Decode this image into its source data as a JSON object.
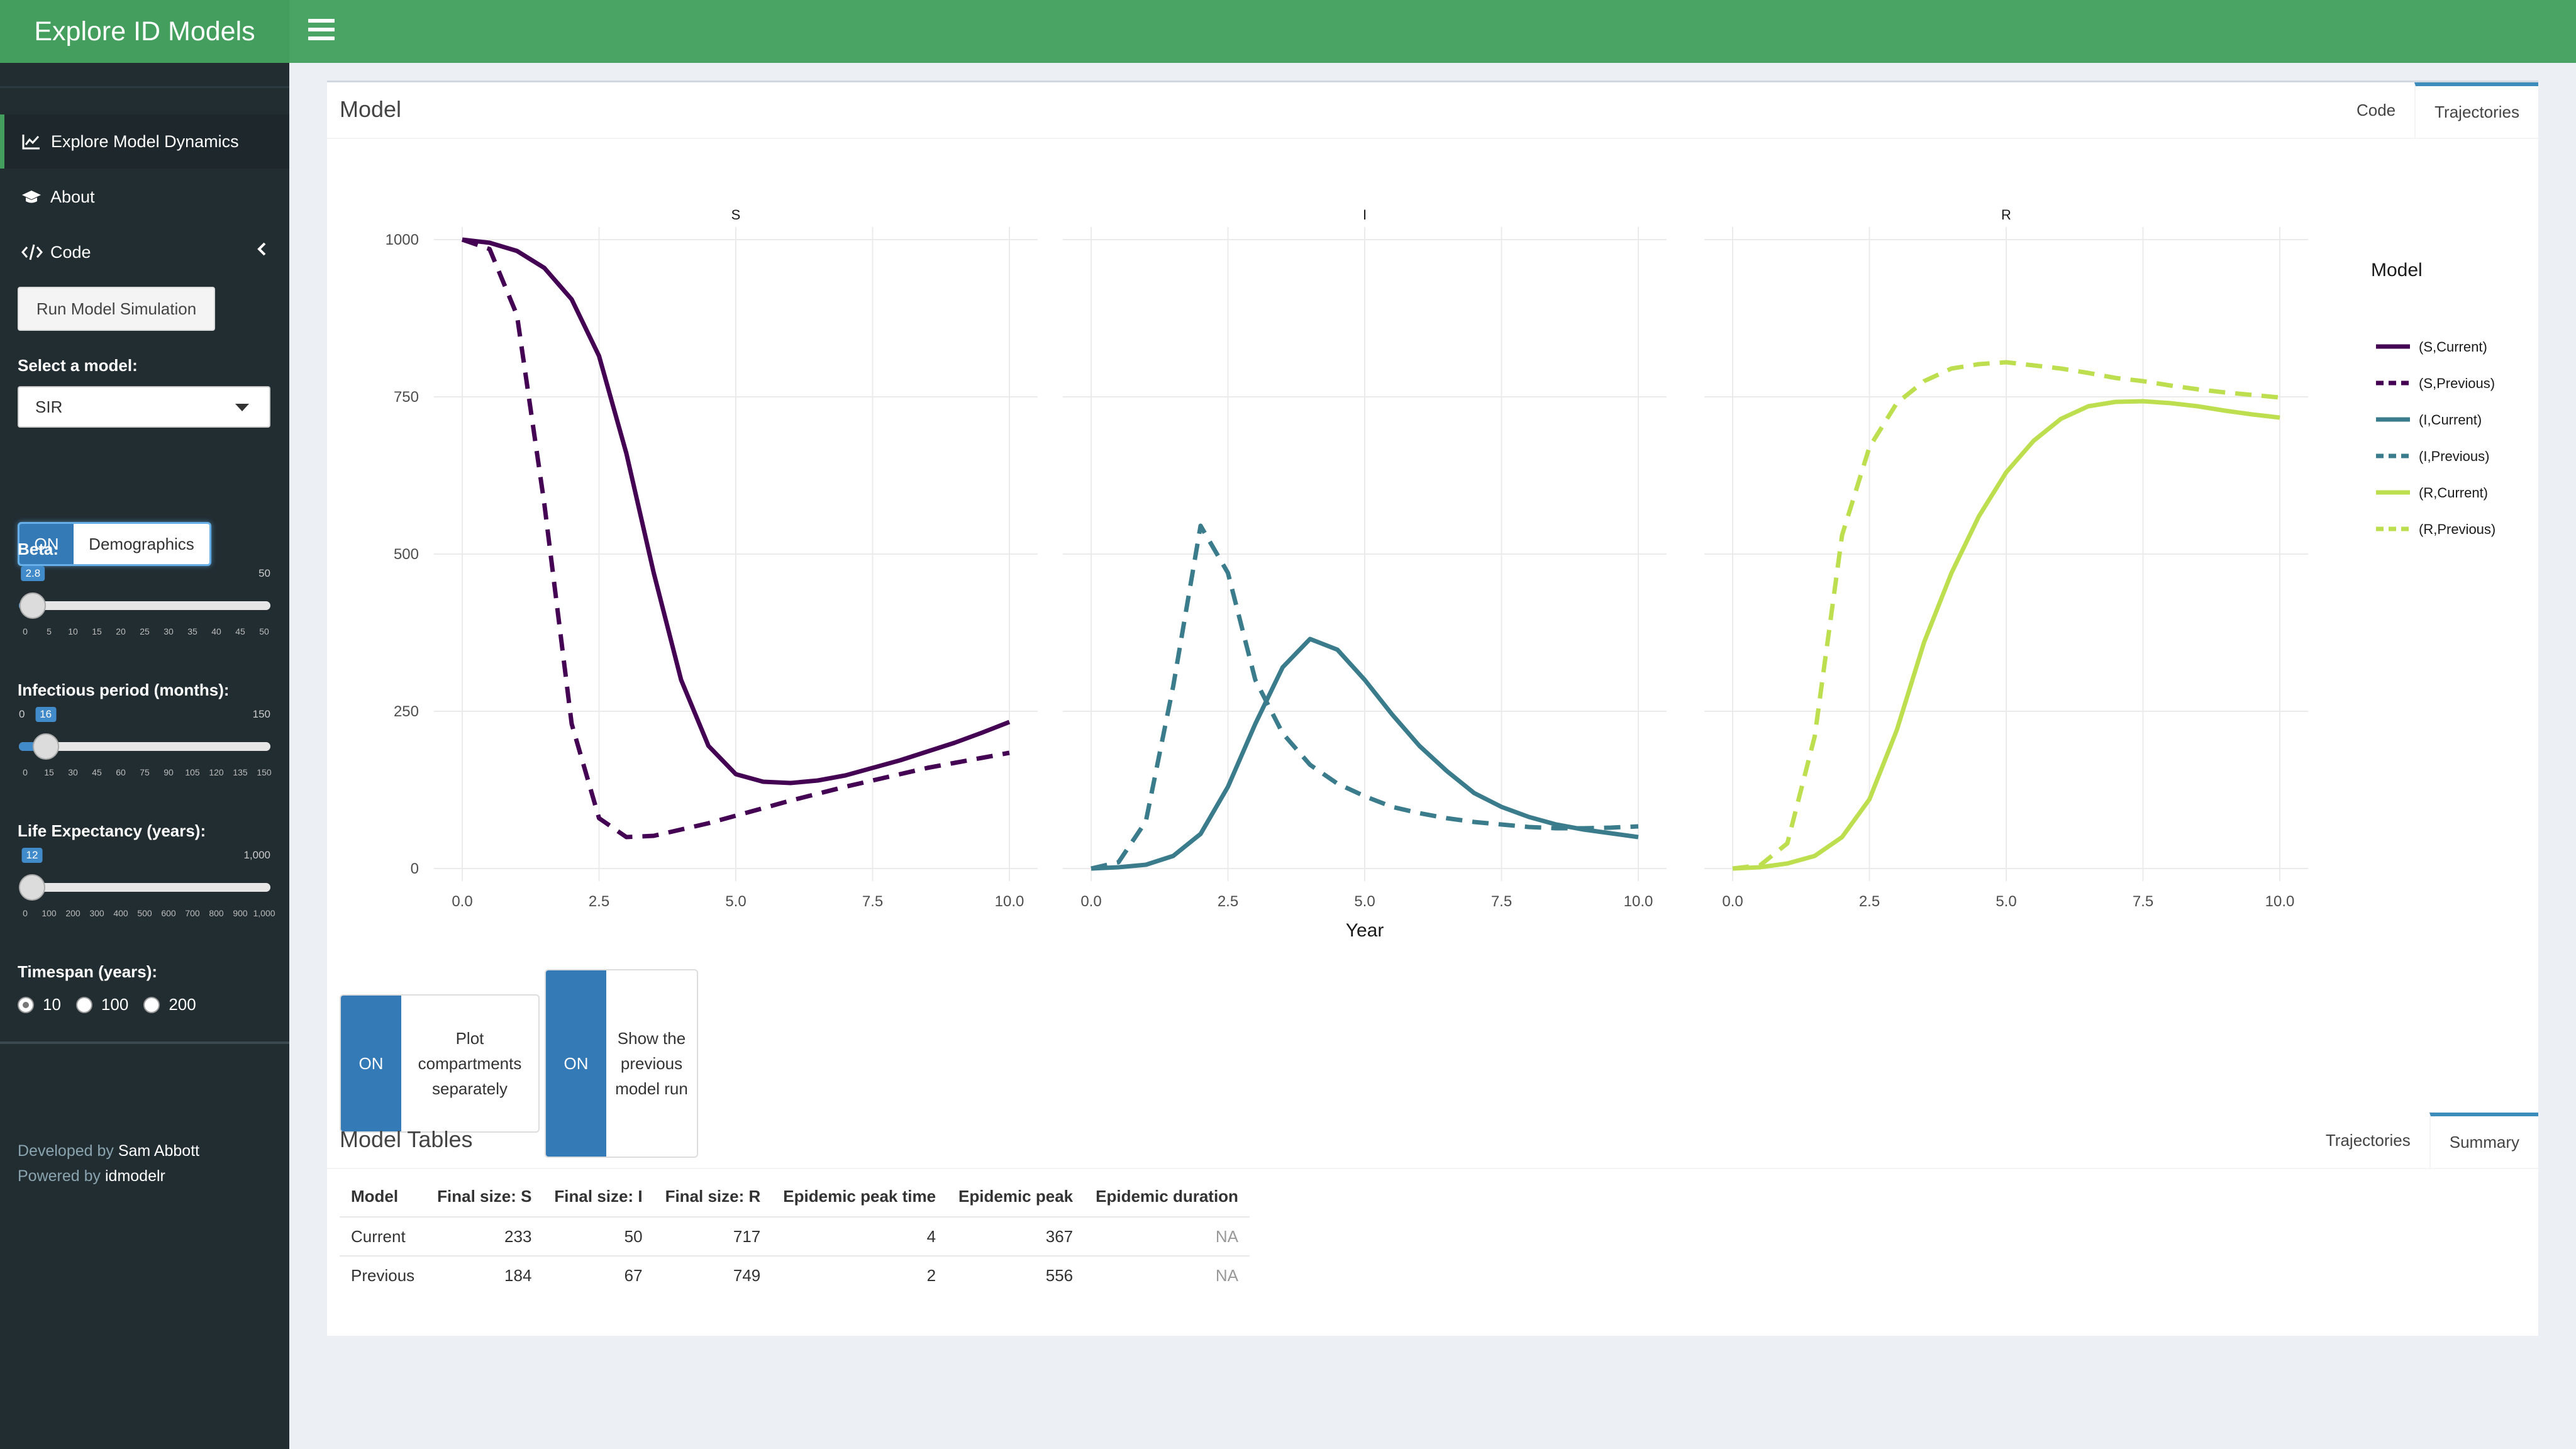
{
  "app": {
    "title": "Explore ID Models"
  },
  "sidebar": {
    "items": [
      {
        "label": "Explore Model Dynamics",
        "icon": "line-chart-icon"
      },
      {
        "label": "About",
        "icon": "graduation-cap-icon"
      },
      {
        "label": "Code",
        "icon": "code-icon"
      }
    ],
    "run_button": "Run Model Simulation",
    "model_label": "Select a model:",
    "model_value": "SIR",
    "demographics": {
      "on": "ON",
      "label": "Demographics"
    },
    "beta": {
      "label": "Beta:",
      "min": "0",
      "max": "50",
      "value": "2.8",
      "value_num": 2.8,
      "min_num": 0,
      "max_num": 50,
      "ticks": [
        "0",
        "5",
        "10",
        "15",
        "20",
        "25",
        "30",
        "35",
        "40",
        "45",
        "50"
      ]
    },
    "infectious": {
      "label": "Infectious period (months):",
      "min": "0",
      "max": "150",
      "value": "16",
      "value_num": 16,
      "min_num": 0,
      "max_num": 150,
      "ticks": [
        "0",
        "15",
        "30",
        "45",
        "60",
        "75",
        "90",
        "105",
        "120",
        "135",
        "150"
      ]
    },
    "life": {
      "label": "Life Expectancy (years):",
      "min": "0",
      "max": "1,000",
      "value": "12",
      "value_num": 12,
      "min_num": 0,
      "max_num": 1000,
      "ticks": [
        "0",
        "100",
        "200",
        "300",
        "400",
        "500",
        "600",
        "700",
        "800",
        "900",
        "1,000"
      ]
    },
    "timespan": {
      "label": "Timespan (years):",
      "options": [
        "10",
        "100",
        "200"
      ],
      "selected": "10"
    },
    "credits": {
      "developed_by": "Developed by",
      "author": "Sam Abbott",
      "powered_by": "Powered by",
      "package": "idmodelr"
    }
  },
  "model_box": {
    "title": "Model",
    "tabs": [
      "Code",
      "Trajectories"
    ],
    "active_tab": "Trajectories"
  },
  "toggles": {
    "plot_separately": {
      "on": "ON",
      "label": "Plot compartments separately"
    },
    "show_previous": {
      "on": "ON",
      "label": "Show the previous model run"
    }
  },
  "tables_box": {
    "title": "Model Tables",
    "tabs": [
      "Trajectories",
      "Summary"
    ],
    "active_tab": "Summary",
    "columns": [
      "Model",
      "Final size: S",
      "Final size: I",
      "Final size: R",
      "Epidemic peak time",
      "Epidemic peak",
      "Epidemic duration"
    ],
    "rows": [
      [
        "Current",
        "233",
        "50",
        "717",
        "4",
        "367",
        "NA"
      ],
      [
        "Previous",
        "184",
        "67",
        "749",
        "2",
        "556",
        "NA"
      ]
    ]
  },
  "chart_data": {
    "type": "line",
    "xlabel": "Year",
    "ylabel": "",
    "facets": [
      "S",
      "I",
      "R"
    ],
    "xlim": [
      0,
      10
    ],
    "ylim": [
      0,
      1000
    ],
    "xticks": [
      "0.0",
      "2.5",
      "5.0",
      "7.5",
      "10.0"
    ],
    "yticks": [
      "0",
      "250",
      "500",
      "750",
      "1000"
    ],
    "legend_title": "Model",
    "legend_position": "right",
    "grid": true,
    "x": [
      0,
      0.5,
      1,
      1.5,
      2,
      2.5,
      3,
      3.5,
      4,
      4.5,
      5,
      5.5,
      6,
      6.5,
      7,
      7.5,
      8,
      8.5,
      9,
      9.5,
      10
    ],
    "series": [
      {
        "name": "(S,Current)",
        "facet": "S",
        "color": "#440154",
        "dash": false,
        "values": [
          1000,
          995,
          982,
          955,
          905,
          815,
          660,
          470,
          300,
          195,
          150,
          138,
          136,
          140,
          148,
          160,
          172,
          186,
          200,
          216,
          233
        ]
      },
      {
        "name": "(S,Previous)",
        "facet": "S",
        "color": "#440154",
        "dash": true,
        "values": [
          1000,
          985,
          880,
          580,
          230,
          80,
          50,
          52,
          62,
          72,
          84,
          96,
          108,
          119,
          130,
          140,
          150,
          160,
          168,
          176,
          184
        ]
      },
      {
        "name": "(I,Current)",
        "facet": "I",
        "color": "#3b7c8c",
        "dash": false,
        "values": [
          0,
          2,
          6,
          20,
          55,
          130,
          230,
          320,
          365,
          348,
          300,
          245,
          195,
          155,
          120,
          98,
          82,
          70,
          62,
          56,
          50
        ]
      },
      {
        "name": "(I,Previous)",
        "facet": "I",
        "color": "#3b7c8c",
        "dash": true,
        "values": [
          0,
          10,
          75,
          290,
          545,
          470,
          300,
          215,
          165,
          135,
          115,
          98,
          88,
          80,
          74,
          70,
          66,
          64,
          64,
          65,
          67
        ]
      },
      {
        "name": "(R,Current)",
        "facet": "R",
        "color": "#bddf4f",
        "dash": false,
        "values": [
          0,
          2,
          8,
          20,
          50,
          110,
          220,
          360,
          470,
          560,
          630,
          680,
          715,
          735,
          742,
          743,
          740,
          735,
          728,
          722,
          717
        ]
      },
      {
        "name": "(R,Previous)",
        "facet": "R",
        "color": "#bddf4f",
        "dash": true,
        "values": [
          0,
          5,
          40,
          210,
          530,
          670,
          740,
          775,
          795,
          802,
          805,
          800,
          795,
          788,
          780,
          775,
          768,
          762,
          757,
          753,
          749
        ]
      }
    ]
  }
}
